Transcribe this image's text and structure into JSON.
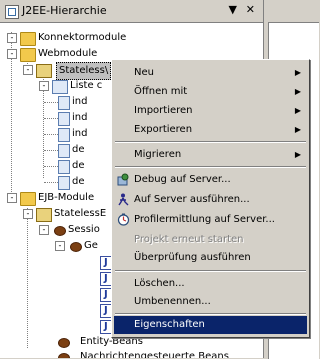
{
  "window": {
    "title": "J2EE-Hierarchie",
    "menu_icon": "chevron-down-icon",
    "close_icon": "close-icon"
  },
  "tree": {
    "connector_modules": "Konnektormodule",
    "web_modules": "Webmodule",
    "stateless_selected": "Stateless\\",
    "liste": "Liste c",
    "children_ind": [
      "ind",
      "ind",
      "ind"
    ],
    "children_de": [
      "de",
      "de",
      "de"
    ],
    "ejb_modules": "EJB-Module",
    "stateless_ejb": "StatelessE",
    "session": "Sessio",
    "ge": "Ge",
    "entity_beans": "Entity-Beans",
    "message_beans": "Nachrichtengesteuerte Beans"
  },
  "context_menu": {
    "items": [
      {
        "label": "Neu",
        "submenu": true
      },
      {
        "label": "Öffnen mit",
        "submenu": true
      },
      {
        "label": "Importieren",
        "submenu": true
      },
      {
        "label": "Exportieren",
        "submenu": true
      },
      {
        "label": "Migrieren",
        "submenu": true
      },
      {
        "label": "Debug auf Server...",
        "icon": "debug-icon"
      },
      {
        "label": "Auf Server ausführen...",
        "icon": "run-icon"
      },
      {
        "label": "Profilermittlung auf Server...",
        "icon": "profile-icon"
      },
      {
        "label": "Projekt erneut starten",
        "disabled": true
      },
      {
        "label": "Überprüfung ausführen"
      },
      {
        "label": "Löschen..."
      },
      {
        "label": "Umbenennen..."
      },
      {
        "label": "Eigenschaften",
        "active": true
      }
    ]
  },
  "colors": {
    "menu_highlight": "#0a246a",
    "panel_bg": "#d4d0c8"
  }
}
